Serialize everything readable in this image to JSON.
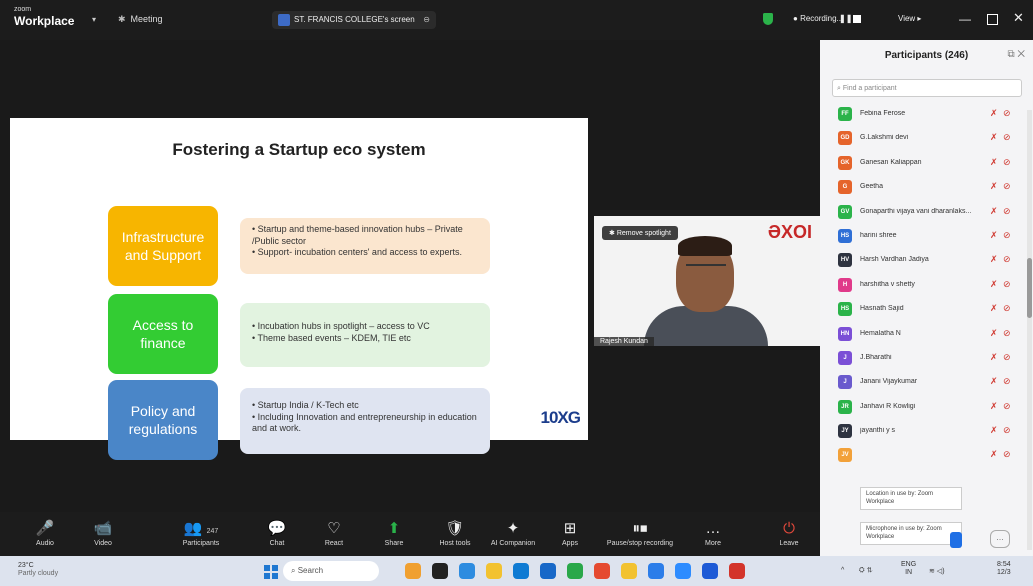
{
  "titlebar": {
    "brand_small": "zoom",
    "brand_big": "Workplace",
    "meeting_label": "Meeting",
    "share_label": "ST. FRANCIS COLLEGE's screen",
    "recording_label": "Recording...",
    "view_label": "View"
  },
  "slide": {
    "title": "Fostering a Startup eco system",
    "rows": [
      {
        "label_line1": "Infrastructure",
        "label_line2": "and Support",
        "bullets": [
          "• Startup and theme-based innovation hubs – Private /Public sector",
          "• Support- incubation centers' and access to experts."
        ],
        "color": "#f7b500",
        "bg": "#fbe6cf"
      },
      {
        "label_line1": "Access to",
        "label_line2": "finance",
        "bullets": [
          "• Incubation hubs in spotlight – access to VC",
          "• Theme based events – KDEM, TIE etc"
        ],
        "color": "#33cc33",
        "bg": "#e2f3e0"
      },
      {
        "label_line1": "Policy and",
        "label_line2": "regulations",
        "bullets": [
          "• Startup India / K-Tech etc",
          "• Including Innovation and entrepreneurship in education and at work."
        ],
        "color": "#4a86c8",
        "bg": "#dfe4f1"
      }
    ],
    "logo_text": "10XG"
  },
  "video": {
    "spotlight_btn": "Remove spotlight",
    "logo": "ƏXOI",
    "name_tag": "Rajesh Kundan"
  },
  "toolbar": {
    "items": [
      {
        "label": "Audio",
        "icon": "🎤",
        "color": "red"
      },
      {
        "label": "Video",
        "icon": "📹",
        "color": "red"
      },
      {
        "label": "Participants",
        "icon": "👥",
        "count": "247"
      },
      {
        "label": "Chat",
        "icon": "💬"
      },
      {
        "label": "React",
        "icon": "♡"
      },
      {
        "label": "Share",
        "icon": "⬆",
        "color": "green"
      },
      {
        "label": "Host tools",
        "icon": "🛡"
      },
      {
        "label": "AI Companion",
        "icon": "✦"
      },
      {
        "label": "Apps",
        "icon": "⊞"
      },
      {
        "label": "Pause/stop recording",
        "icon": "⏸⏹"
      },
      {
        "label": "More",
        "icon": "…"
      },
      {
        "label": "Leave",
        "icon": "⏻",
        "color": "red"
      }
    ]
  },
  "participants": {
    "title": "Participants (246)",
    "search_placeholder": "Find a participant",
    "list": [
      {
        "initials": "FF",
        "name": "Febina Ferose",
        "color": "#2bb34a"
      },
      {
        "initials": "GD",
        "name": "G.Lakshmi devi",
        "color": "#e5642b"
      },
      {
        "initials": "GK",
        "name": "Ganesan Kaliappan",
        "color": "#e5642b"
      },
      {
        "initials": "G",
        "name": "Geetha",
        "color": "#e5642b"
      },
      {
        "initials": "GV",
        "name": "Gonaparthi vijaya vani dharanlaks...",
        "color": "#2bb34a"
      },
      {
        "initials": "HS",
        "name": "harini shree",
        "color": "#2f6fd6"
      },
      {
        "initials": "HV",
        "name": "Harsh Vardhan Jadiya",
        "color": "#2e3340"
      },
      {
        "initials": "H",
        "name": "harshitha v shetty",
        "color": "#e03a8a"
      },
      {
        "initials": "HS",
        "name": "Hasnath Sajid",
        "color": "#2bb34a"
      },
      {
        "initials": "HN",
        "name": "Hemalatha N",
        "color": "#7b4fd6"
      },
      {
        "initials": "J",
        "name": "J.Bharathi",
        "color": "#7b4fd6"
      },
      {
        "initials": "J",
        "name": "Janani Vijaykumar",
        "color": "#6a5acd"
      },
      {
        "initials": "JR",
        "name": "Janhavi R Kowligi",
        "color": "#2bb34a"
      },
      {
        "initials": "JY",
        "name": "jayanthi y s",
        "color": "#2e3340"
      },
      {
        "initials": "JV",
        "name": "",
        "color": "#f2a13a"
      }
    ],
    "toast_location": "Location in use by: Zoom Workplace",
    "toast_mic": "Microphone in use by: Zoom Workplace"
  },
  "taskbar": {
    "temp": "23°C",
    "condition": "Partly cloudy",
    "search": "Search",
    "lang1": "ENG",
    "lang2": "IN",
    "time": "8:54",
    "date": "12/3"
  }
}
